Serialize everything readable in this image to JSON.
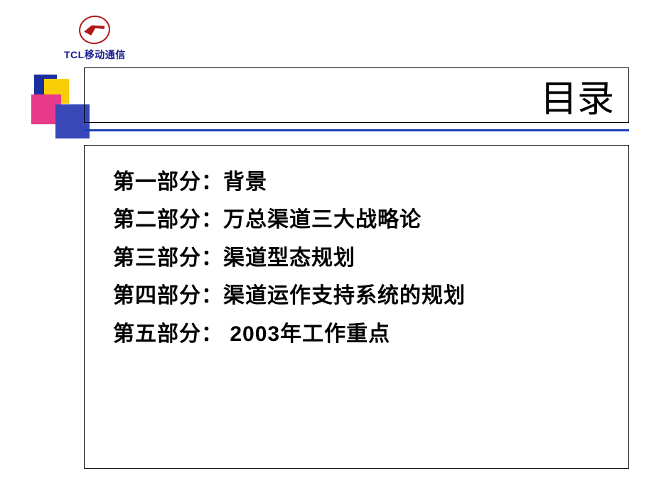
{
  "logo": {
    "brand": "TCL",
    "suffix": "移动通信"
  },
  "title": "目录",
  "toc": [
    "第一部分：背景",
    "第二部分：万总渠道三大战略论",
    "第三部分：渠道型态规划",
    "第四部分：渠道运作支持系统的规划",
    "第五部分： 2003年工作重点"
  ]
}
